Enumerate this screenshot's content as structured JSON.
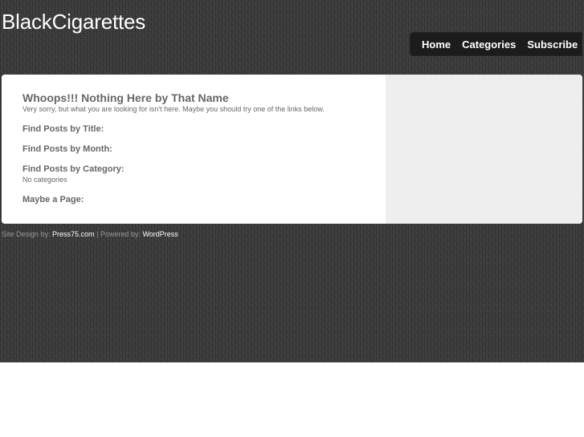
{
  "header": {
    "site_title": "BlackCigarettes"
  },
  "nav": {
    "items": [
      {
        "label": "Home"
      },
      {
        "label": "Categories"
      },
      {
        "label": "Subscribe"
      }
    ]
  },
  "main": {
    "title": "Whoops!!! Nothing Here by That Name",
    "intro": "Very sorry, but what you are looking for isn't here. Maybe you should try one of the links below.",
    "find_by_title": "Find Posts by Title:",
    "find_by_month": "Find Posts by Month:",
    "find_by_category": "Find Posts by Category:",
    "no_categories": "No categories",
    "maybe_page": "Maybe a Page:"
  },
  "footer": {
    "design_prefix": "Site Design by: ",
    "design_link": "Press75.com",
    "separator": " | Powered by: ",
    "powered_link": "WordPress"
  },
  "colors": {
    "background": "#3a3a3a",
    "nav_bg": "#1c1c1c",
    "content_bg": "#ffffff",
    "sidebar_bg": "#eeeeee",
    "heading_text": "#666666"
  }
}
